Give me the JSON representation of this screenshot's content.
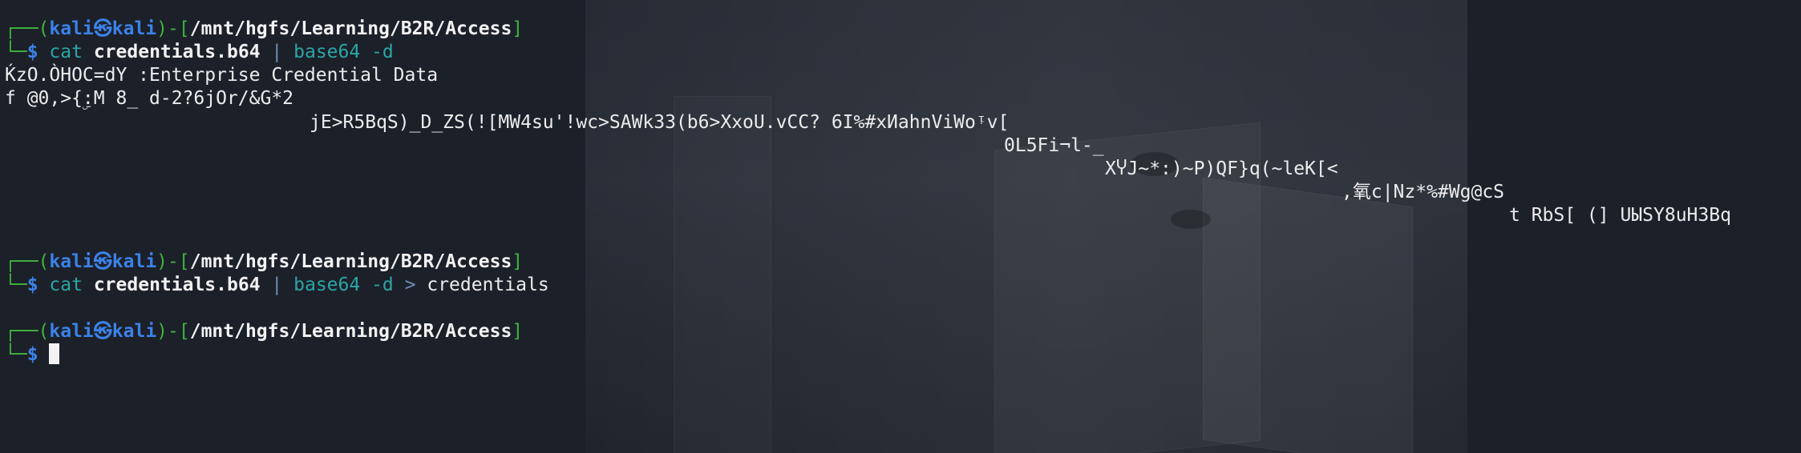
{
  "prompt": {
    "user": "kali",
    "host": "kali",
    "path": "/mnt/hgfs/Learning/B2R/Access",
    "symbol": "$"
  },
  "commands": [
    {
      "cmd": "cat",
      "arg": "credentials.b64",
      "pipe": "|",
      "tool": "base64",
      "flag": "-d",
      "redirect": "",
      "target": ""
    },
    {
      "cmd": "cat",
      "arg": "credentials.b64",
      "pipe": "|",
      "tool": "base64",
      "flag": "-d",
      "redirect": ">",
      "target": "credentials"
    }
  ],
  "output_lines": [
    "ḰzO.ÒHOC=dY :Enterprise Credential Data",
    "f @0,>{ۣ:M 8_ d-2?6jOr/&G*2",
    "jE>R5BqS)_D_ZS(![MW4su'!wc>SAWk33(b6>XxoU.vCC? 6I%#xИahnViWoᵎv[",
    "0L5Fi¬l-_",
    "XჄJ~*:)~P)QF}q(~leK[<",
    ",氧c|Nz*%#Wg@cS",
    "t RbS[ (] UЫSY8uH3Bq"
  ]
}
